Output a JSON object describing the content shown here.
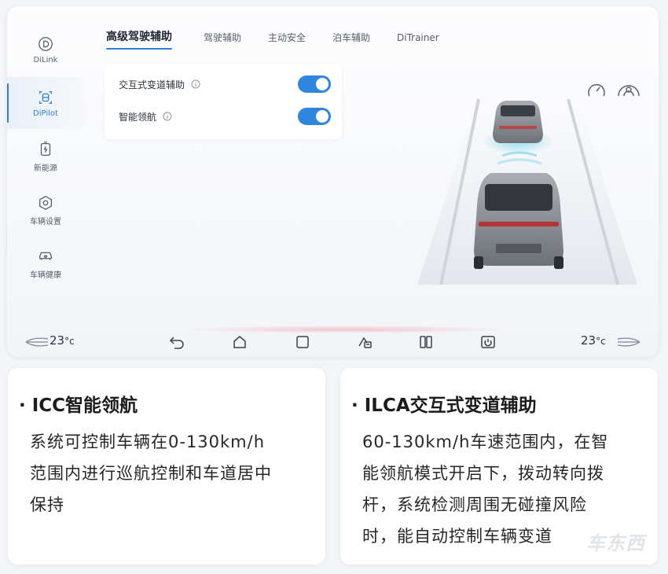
{
  "sidebar": {
    "items": [
      {
        "label": "DiLink",
        "icon": "d-circle-icon"
      },
      {
        "label": "DiPilot",
        "icon": "pilot-icon",
        "active": true
      },
      {
        "label": "新能源",
        "icon": "battery-icon"
      },
      {
        "label": "车辆设置",
        "icon": "settings-hex-icon"
      },
      {
        "label": "车辆健康",
        "icon": "car-heart-icon"
      }
    ]
  },
  "tabs": [
    {
      "label": "高级驾驶辅助",
      "active": true
    },
    {
      "label": "驾驶辅助"
    },
    {
      "label": "主动安全"
    },
    {
      "label": "泊车辅助"
    },
    {
      "label": "DiTrainer"
    }
  ],
  "settings": {
    "lane_change_label": "交互式变道辅助",
    "lane_change_on": true,
    "navigation_label": "智能领航",
    "navigation_on": true
  },
  "bottom_bar": {
    "left_temp": "23",
    "right_temp": "23",
    "unit": "°c",
    "nav_icons": [
      "back-icon",
      "home-icon",
      "square-icon",
      "ac-icon",
      "split-icon",
      "power-icon"
    ]
  },
  "cards": [
    {
      "title": "· ICC智能领航",
      "body_lines": [
        "系统可控制车辆在0-130km/h",
        "范围内进行巡航控制和车道居中",
        "保持"
      ]
    },
    {
      "title": "· ILCA交互式变道辅助",
      "body_lines": [
        "60-130km/h车速范围内，在智",
        "能领航模式开启下，拨动转向拨",
        "杆，系统检测周围无碰撞风险",
        "时，能自动控制车辆变道"
      ]
    }
  ],
  "watermark": "车东西",
  "colors": {
    "accent": "#2c7fd6",
    "toggle": "#2f86dc"
  }
}
